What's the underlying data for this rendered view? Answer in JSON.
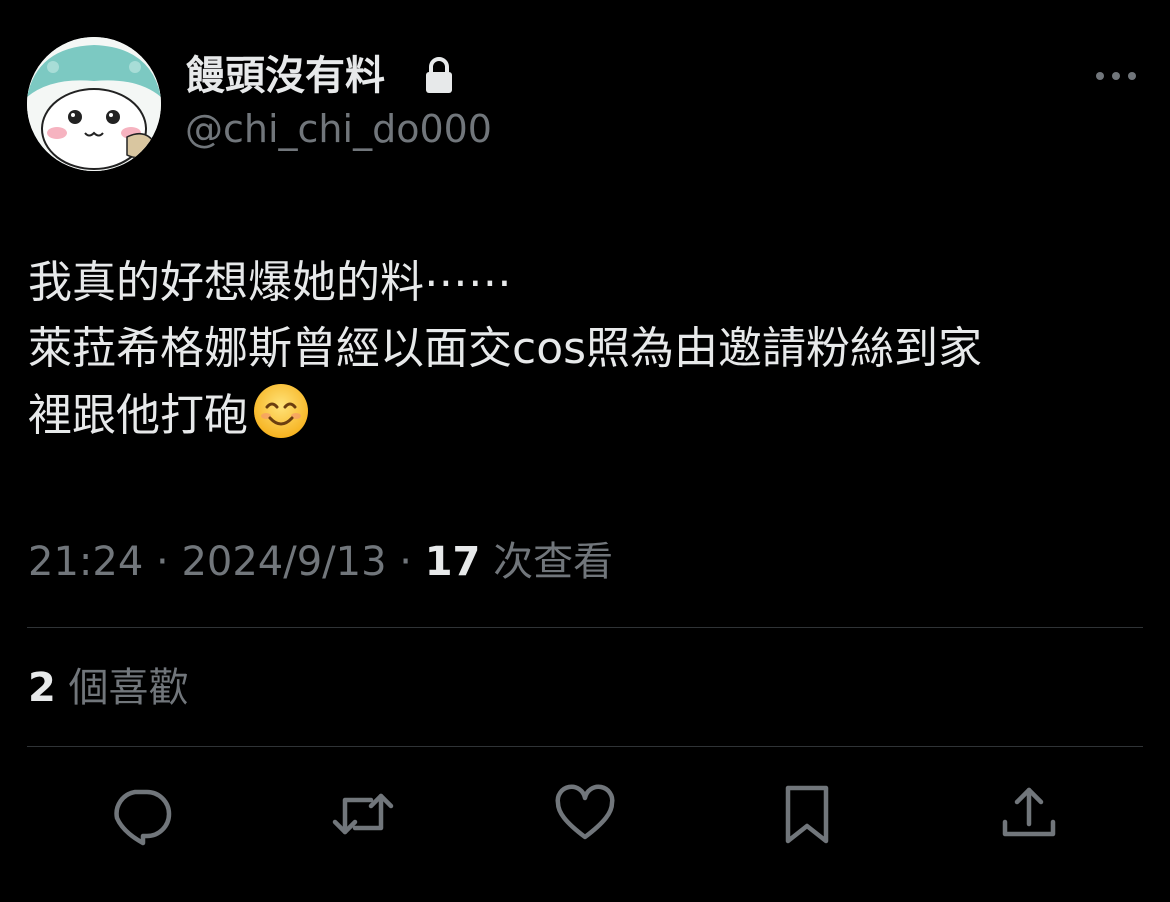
{
  "tweet": {
    "display_name": "饅頭沒有料",
    "handle": "@chi_chi_do000",
    "text_lines": [
      "我真的好想爆她的料⋯⋯",
      "萊菈希格娜斯曾經以面交cos照為由邀請粉絲到家",
      "裡跟他打砲"
    ],
    "emoji": "smiling-face-emoji",
    "time": "21:24",
    "separator": " · ",
    "date": "2024/9/13",
    "views_count": "17",
    "views_label": " 次查看",
    "likes_count": "2",
    "likes_label": " 個喜歡"
  },
  "icons": {
    "lock": "lock-icon",
    "more": "more-horizontal-icon",
    "reply": "reply-icon",
    "retweet": "retweet-icon",
    "like": "heart-icon",
    "bookmark": "bookmark-icon",
    "share": "share-icon"
  },
  "colors": {
    "background": "#000000",
    "primary_text": "#e7e9ea",
    "secondary_text": "#71767b",
    "divider": "#2f3336"
  }
}
